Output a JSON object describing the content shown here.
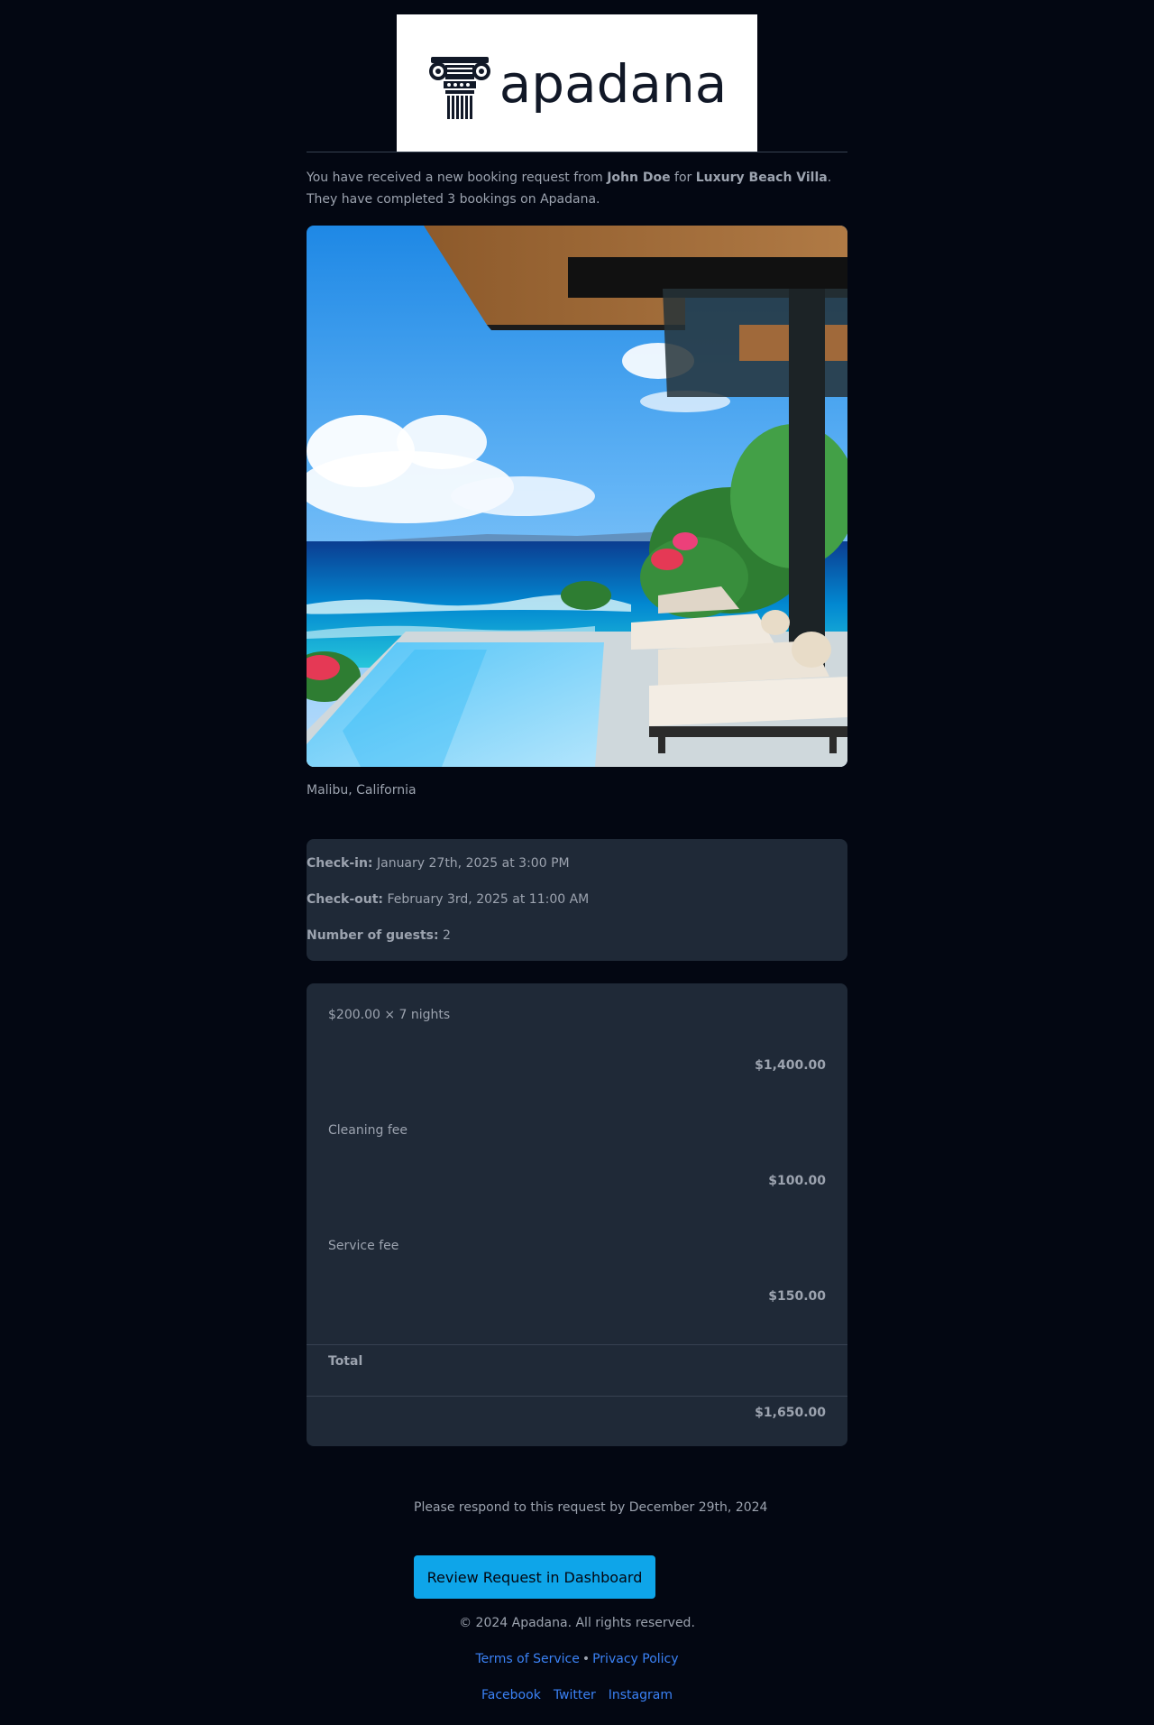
{
  "brand": {
    "name": "apadana",
    "logo_icon": "ionic-column-icon"
  },
  "intro": {
    "prefix": "You have received a new booking request from ",
    "guest_name": "John Doe",
    "middle": " for ",
    "property_name": "Luxury Beach Villa",
    "suffix": ". They have completed 3 bookings on Apadana."
  },
  "listing": {
    "image_alt": "Luxury Beach Villa infinity pool overlooking ocean",
    "location": "Malibu, California"
  },
  "details": {
    "checkin_label": "Check-in:",
    "checkin_value": " January 27th, 2025 at 3:00 PM",
    "checkout_label": "Check-out:",
    "checkout_value": " February 3rd, 2025 at 11:00 AM",
    "guests_label": "Number of guests:",
    "guests_value": " 2"
  },
  "pricing": {
    "rows": [
      {
        "label": "$200.00 × 7 nights",
        "amount": "$1,400.00"
      },
      {
        "label": "Cleaning fee",
        "amount": "$100.00"
      },
      {
        "label": "Service fee",
        "amount": "$150.00"
      }
    ],
    "total_label": "Total",
    "total_amount": "$1,650.00"
  },
  "respond_text": "Please respond to this request by December 29th, 2024",
  "cta_label": "Review Request in Dashboard",
  "footer": {
    "copyright": "© 2024 Apadana. All rights reserved.",
    "terms": "Terms of Service",
    "separator": "•",
    "privacy": "Privacy Policy",
    "social": [
      "Facebook",
      "Twitter",
      "Instagram"
    ]
  },
  "colors": {
    "background": "#030712",
    "card": "#1f2937",
    "accent": "#0ea5e9",
    "link": "#3b82f6"
  }
}
